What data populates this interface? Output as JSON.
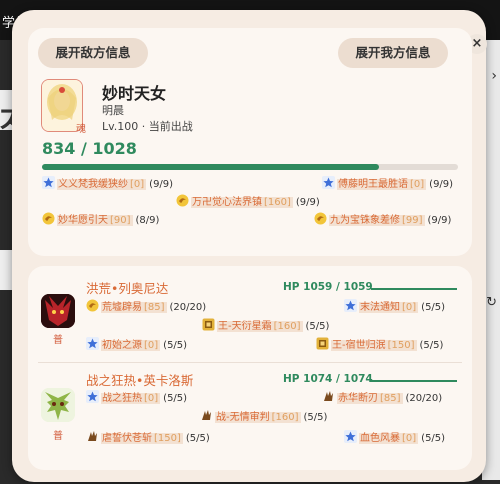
{
  "background": {
    "window_title": "学生",
    "char": "太"
  },
  "buttons": {
    "enemy_info": "展开敌方信息",
    "ally_info": "展开我方信息",
    "close": "×"
  },
  "hero": {
    "name": "妙时天女",
    "subtitle": "明晨",
    "status": "Lv.100 · 当前出战",
    "badge": "魂",
    "hp_text": "834 / 1028",
    "hp_fraction": 0.811,
    "skills": [
      {
        "name": "义义梵我缓狭纱",
        "level": "[0]",
        "count": "(9/9)",
        "icon": "star-blue"
      },
      {
        "name": "傅藤明王最胜语",
        "level": "[0]",
        "count": "(9/9)",
        "icon": "star-blue"
      },
      {
        "name": "万卍觉心法界镇",
        "level": "[160]",
        "count": "(9/9)",
        "icon": "gold-swirl"
      },
      {
        "name": "妙华愿引天",
        "level": "[90]",
        "count": "(8/9)",
        "icon": "gold-swirl"
      },
      {
        "name": "九为宝铢象差修",
        "level": "[99]",
        "count": "(9/9)",
        "icon": "gold-swirl"
      }
    ]
  },
  "monsters": [
    {
      "name": "洪荒•列奥尼达",
      "hp_text": "HP 1059 / 1059",
      "hp_fraction": 1.0,
      "tag": "普",
      "skills": [
        {
          "name": "荒墟辟易",
          "level": "[85]",
          "count": "(20/20)",
          "icon": "gold-swirl"
        },
        {
          "name": "末法通知",
          "level": "[0]",
          "count": "(5/5)",
          "icon": "star-blue"
        },
        {
          "name": "王-天衍星霜",
          "level": "[160]",
          "count": "(5/5)",
          "icon": "gold-box"
        },
        {
          "name": "初始之源",
          "level": "[0]",
          "count": "(5/5)",
          "icon": "star-blue"
        },
        {
          "name": "王-宿世归泯",
          "level": "[150]",
          "count": "(5/5)",
          "icon": "gold-box"
        }
      ]
    },
    {
      "name": "战之狂热•英卡洛斯",
      "hp_text": "HP 1074 / 1074",
      "hp_fraction": 1.0,
      "tag": "普",
      "skills": [
        {
          "name": "战之狂热",
          "level": "[0]",
          "count": "(5/5)",
          "icon": "star-blue"
        },
        {
          "name": "赤华断刃",
          "level": "[85]",
          "count": "(20/20)",
          "icon": "brown-claw"
        },
        {
          "name": "战-无情审判",
          "level": "[160]",
          "count": "(5/5)",
          "icon": "brown-claw"
        },
        {
          "name": "虐誓伏苍斩",
          "level": "[150]",
          "count": "(5/5)",
          "icon": "brown-claw"
        },
        {
          "name": "血色风暴",
          "level": "[0]",
          "count": "(5/5)",
          "icon": "star-blue"
        }
      ]
    }
  ],
  "colors": {
    "accent_green": "#2f8a5e",
    "skill_name": "#d96a36",
    "panel": "#f6ece3"
  }
}
